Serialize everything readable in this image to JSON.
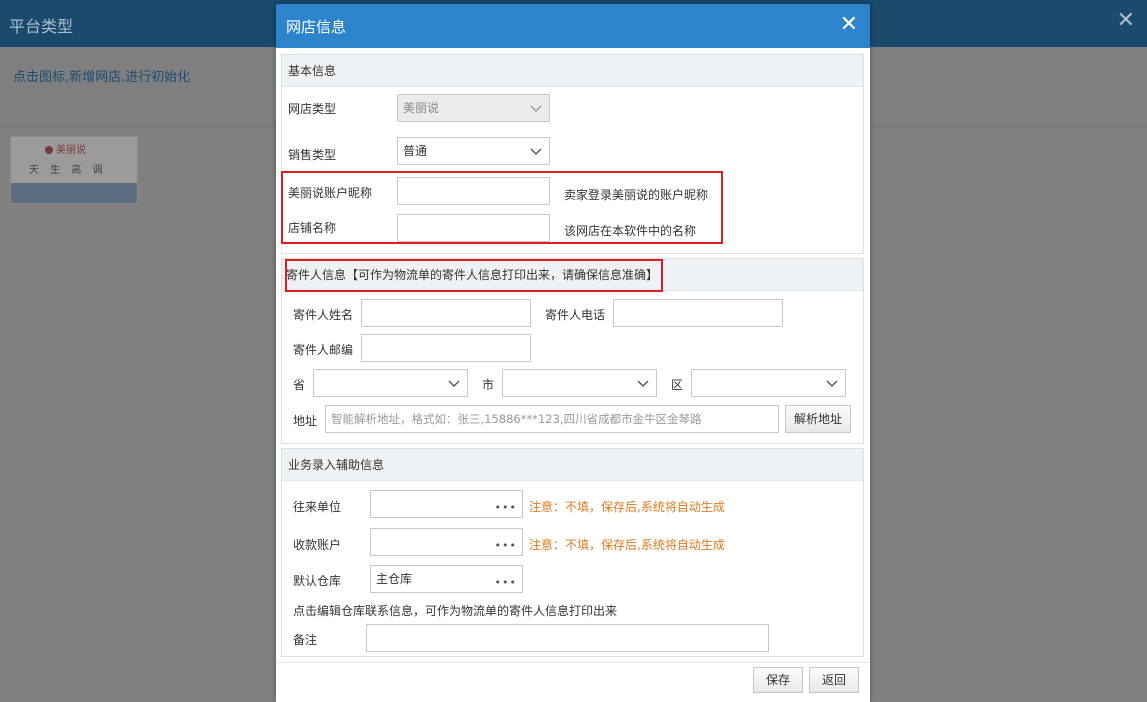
{
  "background": {
    "title": "平台类型",
    "hint": "点击图标,新增网店,进行初始化",
    "card": {
      "logo_text": "美丽说",
      "brand_text": "天 生 高 调"
    }
  },
  "dialog": {
    "title": "网店信息",
    "basic": {
      "heading": "基本信息",
      "shop_type_label": "网店类型",
      "shop_type_value": "美丽说",
      "sale_type_label": "销售类型",
      "sale_type_value": "普通",
      "account_label": "美丽说账户昵称",
      "account_value": "",
      "account_help": "卖家登录美丽说的账户昵称",
      "shop_name_label": "店铺名称",
      "shop_name_value": "",
      "shop_name_help": "该网店在本软件中的名称"
    },
    "sender": {
      "heading": "寄件人信息【可作为物流单的寄件人信息打印出来，请确保信息准确】",
      "name_label": "寄件人姓名",
      "phone_label": "寄件人电话",
      "zip_label": "寄件人邮编",
      "province_label": "省",
      "city_label": "市",
      "district_label": "区",
      "address_label": "地址",
      "address_placeholder": "智能解析地址，格式如：张三,15886***123,四川省成都市金牛区金琴路",
      "parse_button": "解析地址"
    },
    "business": {
      "heading": "业务录入辅助信息",
      "partner_label": "往来单位",
      "partner_note": "注意：不填，保存后,系统将自动生成",
      "account_label": "收款账户",
      "account_note": "注意：不填，保存后,系统将自动生成",
      "warehouse_label": "默认仓库",
      "warehouse_value": "主仓库",
      "warehouse_hint": "点击编辑仓库联系信息，可作为物流单的寄件人信息打印出来",
      "remark_label": "备注"
    },
    "save_button": "保存",
    "back_button": "返回"
  },
  "colors": {
    "accent": "#2c84cc",
    "warning": "#e07a1c",
    "highlight": "#e02020"
  }
}
